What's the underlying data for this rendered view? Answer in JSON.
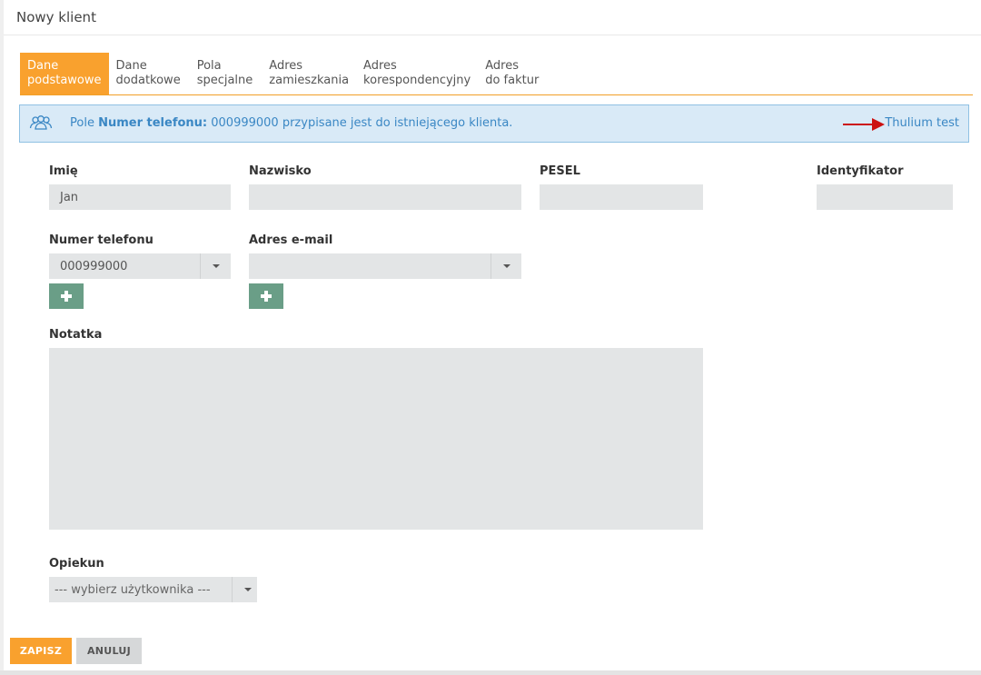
{
  "header": {
    "title": "Nowy klient"
  },
  "tabs": [
    {
      "line1": "Dane",
      "line2": "podstawowe",
      "active": true
    },
    {
      "line1": "Dane",
      "line2": "dodatkowe",
      "active": false
    },
    {
      "line1": "Pola",
      "line2": "specjalne",
      "active": false
    },
    {
      "line1": "Adres",
      "line2": "zamieszkania",
      "active": false
    },
    {
      "line1": "Adres",
      "line2": "korespondencyjny",
      "active": false
    },
    {
      "line1": "Adres",
      "line2": "do faktur",
      "active": false
    }
  ],
  "alert": {
    "prefix": "Pole ",
    "field_name": "Numer telefonu:",
    "suffix": " 000999000 przypisane jest do istniejącego klienta.",
    "link": "Thulium test",
    "color": "#3a87c4",
    "arrow_color": "#cc1111"
  },
  "form": {
    "first_name": {
      "label": "Imię",
      "value": "Jan"
    },
    "last_name": {
      "label": "Nazwisko",
      "value": ""
    },
    "pesel": {
      "label": "PESEL",
      "value": ""
    },
    "identifier": {
      "label": "Identyfikator",
      "value": ""
    },
    "phone": {
      "label": "Numer telefonu",
      "value": "000999000"
    },
    "email": {
      "label": "Adres e-mail",
      "value": ""
    },
    "note": {
      "label": "Notatka",
      "value": ""
    },
    "guardian": {
      "label": "Opiekun",
      "value": "--- wybierz użytkownika ---"
    }
  },
  "actions": {
    "save": "ZAPISZ",
    "cancel": "ANULUJ"
  },
  "colors": {
    "accent": "#f9a12e",
    "add_button": "#6a9e87",
    "field_bg": "#e3e5e6"
  }
}
